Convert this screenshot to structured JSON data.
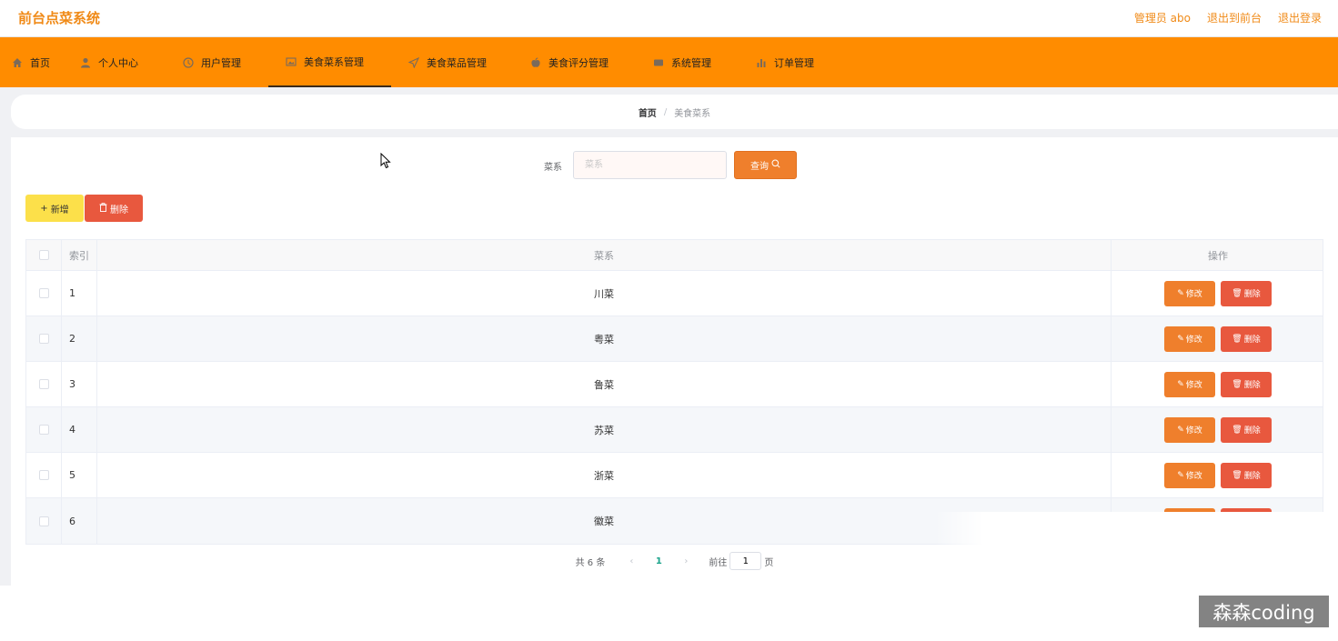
{
  "app": {
    "title": "前台点菜系统",
    "admin_label": "管理员 abo",
    "back_front_label": "退出到前台",
    "logout_label": "退出登录"
  },
  "nav": {
    "items": [
      {
        "label": "首页",
        "icon": "home-icon"
      },
      {
        "label": "个人中心",
        "icon": "user-icon"
      },
      {
        "label": "用户管理",
        "icon": "clock-icon"
      },
      {
        "label": "美食菜系管理",
        "icon": "picture-icon"
      },
      {
        "label": "美食菜品管理",
        "icon": "send-icon"
      },
      {
        "label": "美食评分管理",
        "icon": "apple-icon"
      },
      {
        "label": "系统管理",
        "icon": "message-icon"
      },
      {
        "label": "订单管理",
        "icon": "chart-icon"
      }
    ],
    "active": "美食菜系管理"
  },
  "breadcrumb": {
    "home": "首页",
    "separator": "/",
    "current": "美食菜系"
  },
  "search": {
    "label": "菜系",
    "placeholder": "菜系",
    "button_label": "查询"
  },
  "actions": {
    "add_label": "新增",
    "delete_label": "删除"
  },
  "table": {
    "columns": [
      "索引",
      "菜系",
      "操作"
    ],
    "rows": [
      {
        "index": "1",
        "name": "川菜"
      },
      {
        "index": "2",
        "name": "粤菜"
      },
      {
        "index": "3",
        "name": "鲁菜"
      },
      {
        "index": "4",
        "name": "苏菜"
      },
      {
        "index": "5",
        "name": "浙菜"
      },
      {
        "index": "6",
        "name": "徽菜"
      }
    ],
    "edit_label": "修改",
    "delete_label": "删除"
  },
  "pagination": {
    "total_text": "共 6 条",
    "current_page": "1",
    "goto_label": "前往",
    "goto_value": "1",
    "page_suffix": "页"
  },
  "watermark": "森森coding",
  "colors": {
    "brand_orange": "#ff8c00",
    "button_orange": "#ef7f2c",
    "danger_red": "#e8583e",
    "add_yellow": "#fce04a",
    "page_active": "#1aa38a"
  }
}
